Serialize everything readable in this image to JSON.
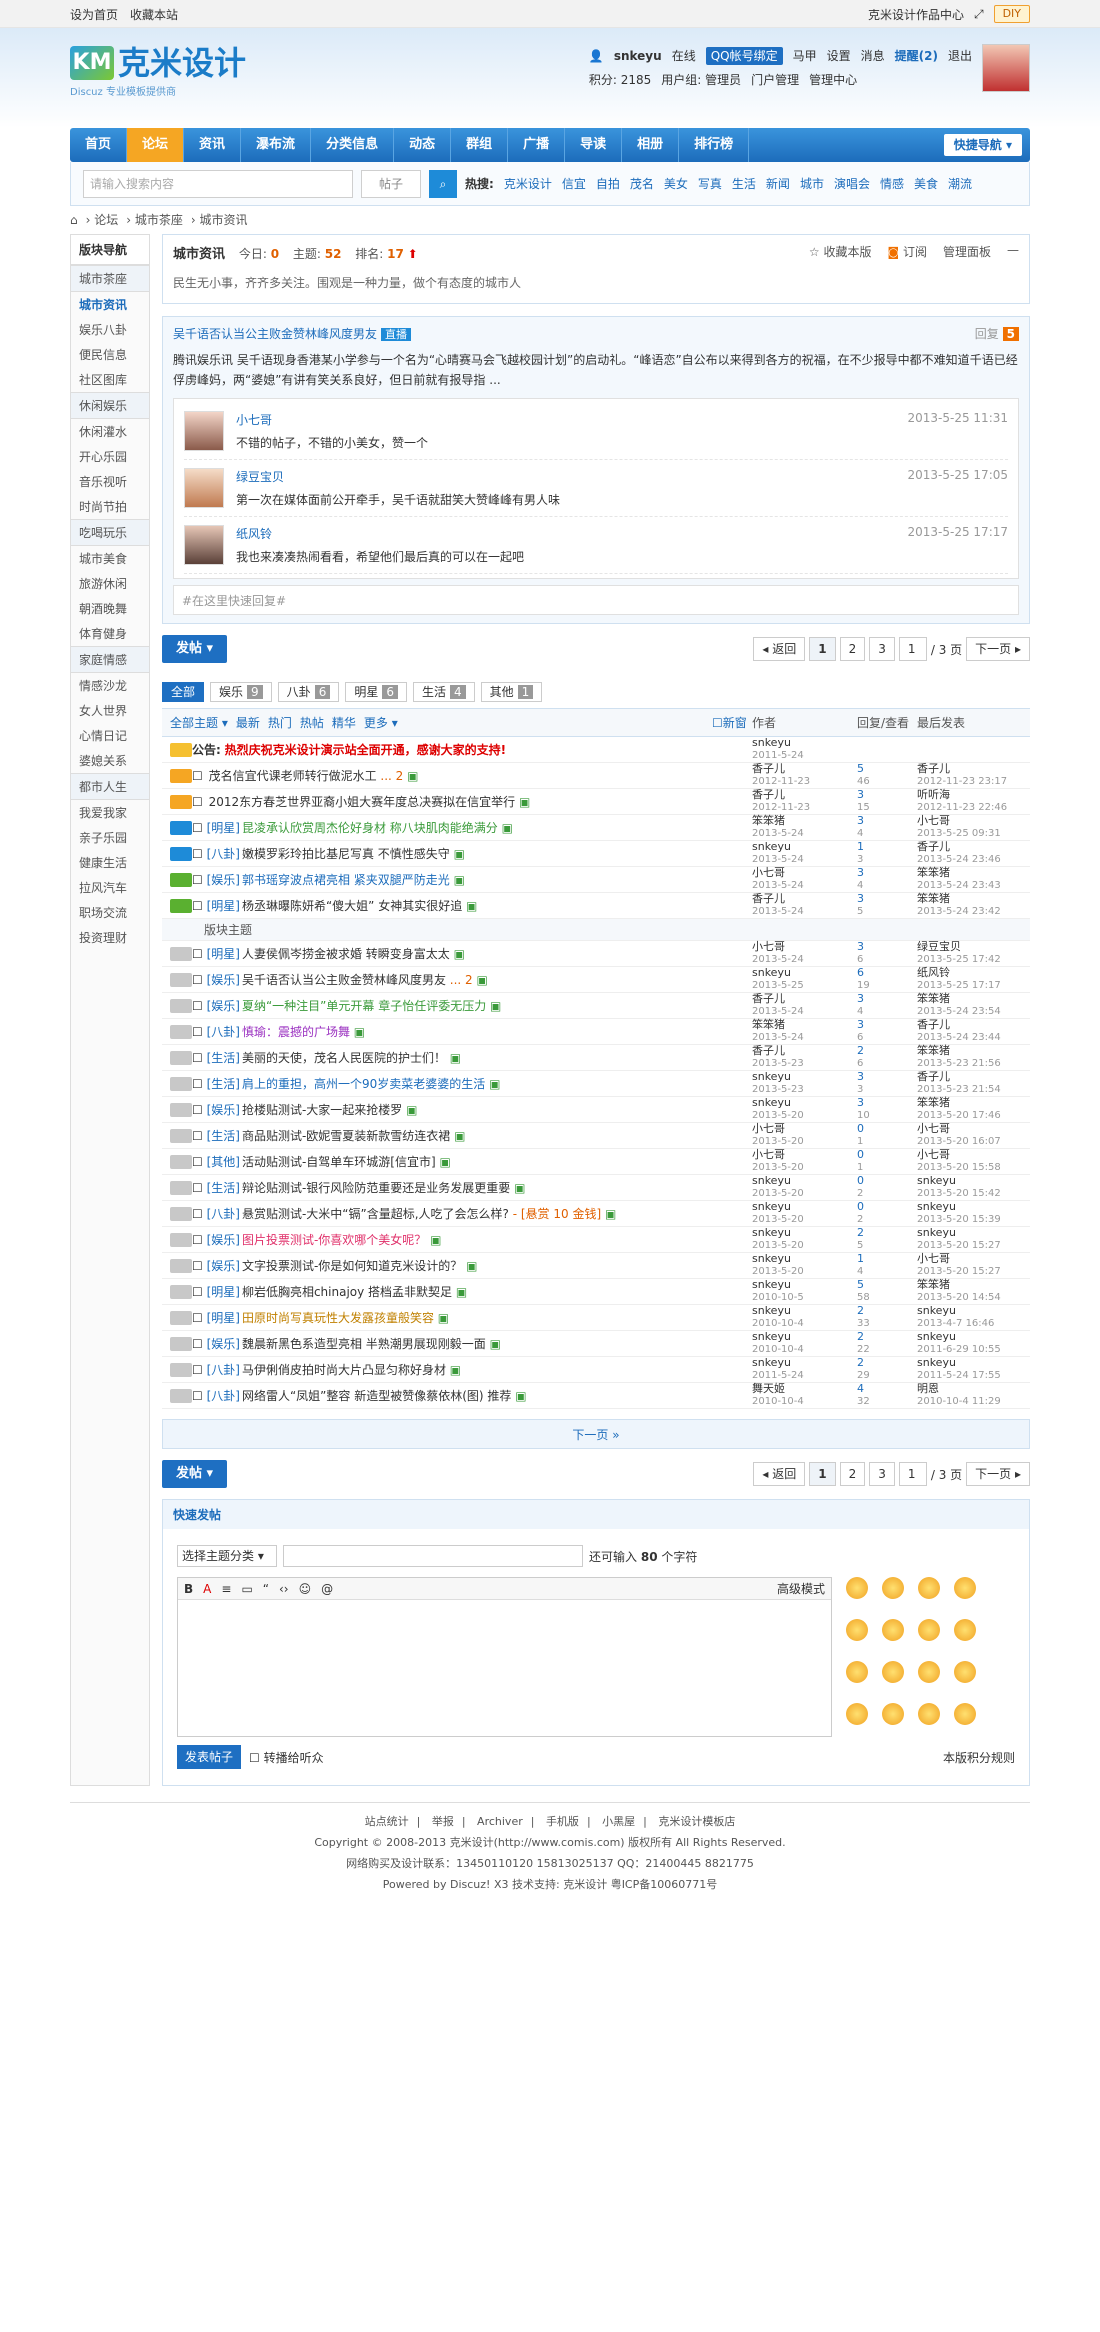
{
  "topbar": {
    "set_home": "设为首页",
    "bookmark": "收藏本站",
    "works": "克米设计作品中心",
    "diy": "DIY"
  },
  "logo": {
    "name": "克米设计",
    "sub": "Discuz 专业模板提供商",
    "mark": "KM"
  },
  "user": {
    "name": "snkeyu",
    "status": "在线",
    "qq": "QQ帐号绑定",
    "horse": "马甲",
    "settings": "设置",
    "msg": "消息",
    "remind": "提醒(2)",
    "logout": "退出",
    "points": "积分: 2185",
    "group": "用户组: 管理员",
    "portal": "门户管理",
    "admin": "管理中心"
  },
  "nav": {
    "items": [
      "首页",
      "论坛",
      "资讯",
      "瀑布流",
      "分类信息",
      "动态",
      "群组",
      "广播",
      "导读",
      "相册",
      "排行榜"
    ],
    "quick": "快捷导航 ▾"
  },
  "search": {
    "placeholder": "请输入搜索内容",
    "type": "帖子",
    "hot_label": "热搜:",
    "hot": [
      "克米设计",
      "信宜",
      "自拍",
      "茂名",
      "美女",
      "写真",
      "生活",
      "新闻",
      "城市",
      "演唱会",
      "情感",
      "美食",
      "潮流"
    ]
  },
  "bread": [
    "论坛",
    "城市茶座",
    "城市资讯"
  ],
  "side": {
    "head": "版块导航",
    "groups": [
      {
        "name": "城市茶座",
        "items": [
          "城市资讯",
          "娱乐八卦",
          "便民信息",
          "社区图库"
        ]
      },
      {
        "name": "休闲娱乐",
        "items": [
          "休闲灌水",
          "开心乐园",
          "音乐视听",
          "时尚节拍"
        ]
      },
      {
        "name": "吃喝玩乐",
        "items": [
          "城市美食",
          "旅游休闲",
          "朝酒晚舞",
          "体育健身"
        ]
      },
      {
        "name": "家庭情感",
        "items": [
          "情感沙龙",
          "女人世界",
          "心情日记",
          "婆媳关系"
        ]
      },
      {
        "name": "都市人生",
        "items": [
          "我爱我家",
          "亲子乐园",
          "健康生活",
          "拉风汽车",
          "职场交流",
          "投资理财"
        ]
      }
    ]
  },
  "forum": {
    "name": "城市资讯",
    "today": "今日: ",
    "today_v": "0",
    "topics": "主题: ",
    "topics_v": "52",
    "rank": "排名: ",
    "rank_v": "17",
    "desc": "民生无小事，齐齐多关注。围观是一种力量，做个有态度的城市人",
    "fav": "收藏本版",
    "rss": "订阅",
    "manage": "管理面板"
  },
  "pinned": {
    "title": "吴千语否认当公主败金赞林峰风度男友",
    "live": "直播",
    "reply_label": "回复",
    "reply_count": "5",
    "summary": "腾讯娱乐讯 吴千语现身香港某小学参与一个名为“心晴赛马会飞越校园计划”的启动礼。“峰语恋”自公布以来得到各方的祝福，在不少报导中都不难知道千语已经俘虏峰妈，两“婆媳”有讲有笑关系良好，但日前就有报导指 ...",
    "replies": [
      {
        "name": "小七哥",
        "text": "不错的帖子，不错的小美女，赞一个",
        "time": "2013-5-25 11:31"
      },
      {
        "name": "绿豆宝贝",
        "text": "第一次在媒体面前公开牵手，吴千语就甜笑大赞峰峰有男人味",
        "time": "2013-5-25 17:05"
      },
      {
        "name": "纸风铃",
        "text": "我也来凑凑热闹看看，希望他们最后真的可以在一起吧",
        "time": "2013-5-25 17:17"
      }
    ],
    "quick": "#在这里快速回复#"
  },
  "pager": {
    "post": "发帖 ▾",
    "back": "◂ 返回",
    "pages": [
      "1",
      "2",
      "3"
    ],
    "input": "1",
    "total": "/ 3 页",
    "next": "下一页 ▸"
  },
  "tabs": [
    {
      "label": "全部",
      "count": ""
    },
    {
      "label": "娱乐",
      "count": "9"
    },
    {
      "label": "八卦",
      "count": "6"
    },
    {
      "label": "明星",
      "count": "6"
    },
    {
      "label": "生活",
      "count": "4"
    },
    {
      "label": "其他",
      "count": "1"
    }
  ],
  "thead": {
    "filters": [
      "全部主题 ▾",
      "最新",
      "热门",
      "热帖",
      "精华",
      "更多 ▾"
    ],
    "newwin": "新窗",
    "author": "作者",
    "reply": "回复/查看",
    "last": "最后发表"
  },
  "announce": {
    "label": "公告:",
    "text": "热烈庆祝克米设计演示站全面开通，感谢大家的支持!",
    "author": "snkeyu",
    "date": "2011-5-24"
  },
  "sticky": [
    {
      "cat": "",
      "title": "茂名信宜代课老师转行做泥水工",
      "extra": "... 2",
      "author": "香子儿",
      "date": "2012-11-23",
      "r": "5",
      "v": "46",
      "last": "香子儿",
      "ldate": "2012-11-23 23:17",
      "color": "#333"
    },
    {
      "cat": "",
      "title": "2012东方春芝世界亚裔小姐大赛年度总决赛拟在信宜举行",
      "extra": "",
      "author": "香子儿",
      "date": "2012-11-23",
      "r": "3",
      "v": "15",
      "last": "听听海",
      "ldate": "2012-11-23 22:46",
      "color": "#333"
    },
    {
      "cat": "[明星]",
      "title": "昆凌承认欣赏周杰伦好身材 称八块肌肉能绝满分",
      "extra": "",
      "author": "笨笨猪",
      "date": "2013-5-24",
      "r": "3",
      "v": "4",
      "last": "小七哥",
      "ldate": "2013-5-25 09:31",
      "color": "#3a9a3a"
    },
    {
      "cat": "[八卦]",
      "title": "嫩模罗彩玲拍比基尼写真 不慎性感失守",
      "extra": "",
      "author": "snkeyu",
      "date": "2013-5-24",
      "r": "1",
      "v": "3",
      "last": "香子儿",
      "ldate": "2013-5-24 23:46",
      "color": "#333"
    },
    {
      "cat": "[娱乐]",
      "title": "郭书瑶穿波点裙亮相 紧夹双腿严防走光",
      "extra": "",
      "author": "小七哥",
      "date": "2013-5-24",
      "r": "3",
      "v": "4",
      "last": "笨笨猪",
      "ldate": "2013-5-24 23:43",
      "color": "#1c6cbb"
    },
    {
      "cat": "[明星]",
      "title": "杨丞琳曝陈妍希“傻大姐” 女神其实很好追",
      "extra": "",
      "author": "香子儿",
      "date": "2013-5-24",
      "r": "3",
      "v": "5",
      "last": "笨笨猪",
      "ldate": "2013-5-24 23:42",
      "color": "#333"
    }
  ],
  "sep_label": "版块主题",
  "threads": [
    {
      "cat": "[明星]",
      "title": "人妻侯佩岑捞金被求婚 转瞬变身富太太",
      "extra": "",
      "author": "小七哥",
      "date": "2013-5-24",
      "r": "3",
      "v": "6",
      "last": "绿豆宝贝",
      "ldate": "2013-5-25 17:42",
      "color": "#333"
    },
    {
      "cat": "[娱乐]",
      "title": "吴千语否认当公主败金赞林峰风度男友",
      "extra": "... 2",
      "author": "snkeyu",
      "date": "2013-5-25",
      "r": "6",
      "v": "19",
      "last": "纸风铃",
      "ldate": "2013-5-25 17:17",
      "color": "#333"
    },
    {
      "cat": "[娱乐]",
      "title": "夏纳“一种注目”单元开幕 章子怡任评委无压力",
      "extra": "",
      "author": "香子儿",
      "date": "2013-5-24",
      "r": "3",
      "v": "4",
      "last": "笨笨猪",
      "ldate": "2013-5-24 23:54",
      "color": "#3a9a3a"
    },
    {
      "cat": "[八卦]",
      "title": "慎瑜：震撼的广场舞",
      "extra": "",
      "author": "笨笨猪",
      "date": "2013-5-24",
      "r": "3",
      "v": "6",
      "last": "香子儿",
      "ldate": "2013-5-24 23:44",
      "color": "#9a30c0"
    },
    {
      "cat": "[生活]",
      "title": "美丽的天使，茂名人民医院的护士们！",
      "extra": "",
      "author": "香子儿",
      "date": "2013-5-23",
      "r": "2",
      "v": "6",
      "last": "笨笨猪",
      "ldate": "2013-5-23 21:56",
      "color": "#333"
    },
    {
      "cat": "[生活]",
      "title": "肩上的重担，高州一个90岁卖菜老婆婆的生活",
      "extra": "",
      "author": "snkeyu",
      "date": "2013-5-23",
      "r": "3",
      "v": "3",
      "last": "香子儿",
      "ldate": "2013-5-23 21:54",
      "color": "#1c6cbb"
    },
    {
      "cat": "[娱乐]",
      "title": "抢楼贴测试-大家一起来抢楼罗",
      "extra": "",
      "author": "snkeyu",
      "date": "2013-5-20",
      "r": "3",
      "v": "10",
      "last": "笨笨猪",
      "ldate": "2013-5-20 17:46",
      "color": "#333"
    },
    {
      "cat": "[生活]",
      "title": "商品贴测试-欧妮雪夏装新款雪纺连衣裙",
      "extra": "",
      "author": "小七哥",
      "date": "2013-5-20",
      "r": "0",
      "v": "1",
      "last": "小七哥",
      "ldate": "2013-5-20 16:07",
      "color": "#333"
    },
    {
      "cat": "[其他]",
      "title": "活动贴测试-自驾单车环城游[信宜市]",
      "extra": "",
      "author": "小七哥",
      "date": "2013-5-20",
      "r": "0",
      "v": "1",
      "last": "小七哥",
      "ldate": "2013-5-20 15:58",
      "color": "#333"
    },
    {
      "cat": "[生活]",
      "title": "辩论贴测试-银行风险防范重要还是业务发展更重要",
      "extra": "",
      "author": "snkeyu",
      "date": "2013-5-20",
      "r": "0",
      "v": "2",
      "last": "snkeyu",
      "ldate": "2013-5-20 15:42",
      "color": "#333"
    },
    {
      "cat": "[八卦]",
      "title": "悬赏贴测试-大米中“镉”含量超标,人吃了会怎么样?",
      "extra": "- [悬赏 10 金钱]",
      "author": "snkeyu",
      "date": "2013-5-20",
      "r": "0",
      "v": "2",
      "last": "snkeyu",
      "ldate": "2013-5-20 15:39",
      "color": "#333"
    },
    {
      "cat": "[娱乐]",
      "title": "图片投票测试-你喜欢哪个美女呢？",
      "extra": "",
      "author": "snkeyu",
      "date": "2013-5-20",
      "r": "2",
      "v": "5",
      "last": "snkeyu",
      "ldate": "2013-5-20 15:27",
      "color": "#e0306a"
    },
    {
      "cat": "[娱乐]",
      "title": "文字投票测试-你是如何知道克米设计的？",
      "extra": "",
      "author": "snkeyu",
      "date": "2013-5-20",
      "r": "1",
      "v": "4",
      "last": "小七哥",
      "ldate": "2013-5-20 15:27",
      "color": "#333"
    },
    {
      "cat": "[明星]",
      "title": "柳岩低胸亮相chinajoy 搭档孟非默契足",
      "extra": "",
      "author": "snkeyu",
      "date": "2010-10-5",
      "r": "5",
      "v": "58",
      "last": "笨笨猪",
      "ldate": "2013-5-20 14:54",
      "color": "#333"
    },
    {
      "cat": "[明星]",
      "title": "田原时尚写真玩性大发露孩童般笑容",
      "extra": "",
      "author": "snkeyu",
      "date": "2010-10-4",
      "r": "2",
      "v": "33",
      "last": "snkeyu",
      "ldate": "2013-4-7 16:46",
      "color": "#c08000"
    },
    {
      "cat": "[娱乐]",
      "title": "魏晨新黑色系造型亮相 半熟潮男展现刚毅一面",
      "extra": "",
      "author": "snkeyu",
      "date": "2010-10-4",
      "r": "2",
      "v": "22",
      "last": "snkeyu",
      "ldate": "2011-6-29 10:55",
      "color": "#333"
    },
    {
      "cat": "[八卦]",
      "title": "马伊俐俏皮拍时尚大片凸显匀称好身材",
      "extra": "",
      "author": "snkeyu",
      "date": "2011-5-24",
      "r": "2",
      "v": "29",
      "last": "snkeyu",
      "ldate": "2011-5-24 17:55",
      "color": "#333"
    },
    {
      "cat": "[八卦]",
      "title": "网络雷人“凤姐”整容 新造型被赞像蔡依林(图) 推荐",
      "extra": "",
      "author": "舞天姬",
      "date": "2010-10-4",
      "r": "4",
      "v": "32",
      "last": "明恩",
      "ldate": "2010-10-4 11:29",
      "color": "#333"
    }
  ],
  "nextbar": "下一页 »",
  "fastpost": {
    "head": "快速发帖",
    "select": "选择主题分类 ▾",
    "limit_pre": "还可输入",
    "limit": "80",
    "limit_post": "个字符",
    "advanced": "高级模式",
    "submit": "发表帖子",
    "sync": "转播给听众",
    "rules": "本版积分规则",
    "tools": [
      "B",
      "A",
      "≡",
      "▭",
      "“",
      "‹›",
      "☺",
      "@"
    ]
  },
  "footer": {
    "links": [
      "站点统计",
      "举报",
      "Archiver",
      "手机版",
      "小黑屋",
      "克米设计模板店"
    ],
    "copy": "Copyright © 2008-2013 克米设计(http://www.comis.com) 版权所有 All Rights Reserved.",
    "contact": "网络购买及设计联系：13450110120 15813025137 QQ：21400445 8821775",
    "powered": "Powered by Discuz! X3  技术支持: 克米设计 粤ICP备10060771号"
  },
  "colors": {
    "accent": "#1e6fc2",
    "nav_on": "#f5a623",
    "link": "#1c6cbb"
  }
}
